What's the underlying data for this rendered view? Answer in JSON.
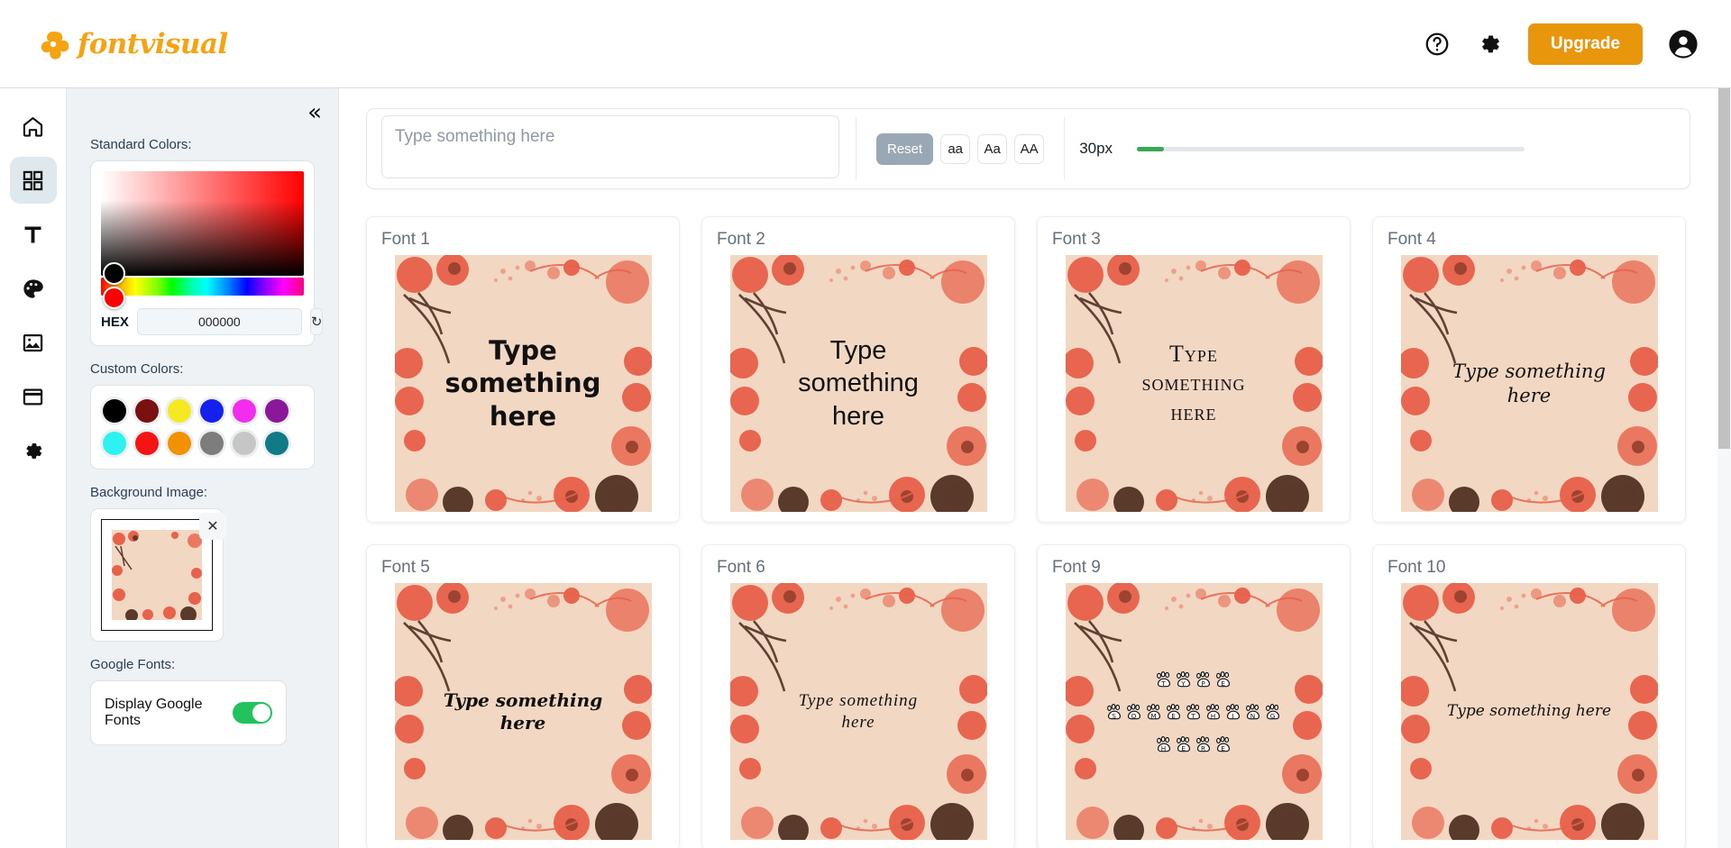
{
  "header": {
    "logo_text": "fontvisual",
    "logo_icon": "pinwheel-flower-icon",
    "help_icon": "question-circle-icon",
    "settings_icon": "gear-icon",
    "upgrade_label": "Upgrade",
    "account_icon": "user-circle-icon",
    "accent_color": "#E8960C"
  },
  "rail": {
    "items": [
      {
        "name": "home",
        "icon": "home-icon",
        "active": false
      },
      {
        "name": "templates",
        "icon": "grid-icon",
        "active": true
      },
      {
        "name": "text",
        "icon": "text-t-icon",
        "active": false
      },
      {
        "name": "colors",
        "icon": "palette-icon",
        "active": false
      },
      {
        "name": "images",
        "icon": "image-icon",
        "active": false
      },
      {
        "name": "frames",
        "icon": "window-icon",
        "active": false
      },
      {
        "name": "settings",
        "icon": "gear-icon",
        "active": false
      }
    ]
  },
  "panel": {
    "collapse_icon": "double-chevron-left-icon",
    "standard_colors_label": "Standard Colors:",
    "hex_label": "HEX",
    "hex_value": "000000",
    "refresh_icon": "refresh-icon",
    "custom_colors_label": "Custom Colors:",
    "custom_colors": [
      "#000000",
      "#7B1010",
      "#F7E920",
      "#1420EE",
      "#F22DEE",
      "#8B179B",
      "#2DF2F2",
      "#F51414",
      "#F39200",
      "#7D7D7D",
      "#C6C6C6",
      "#117A87"
    ],
    "background_image_label": "Background Image:",
    "background_remove_icon": "close-x-icon",
    "google_fonts_label": "Google Fonts:",
    "display_google_fonts_label": "Display Google Fonts",
    "display_google_fonts_on": true,
    "toggle_on_color": "#22c35e"
  },
  "toolbar": {
    "input_value": "",
    "input_placeholder": "Type something here",
    "reset_label": "Reset",
    "case_lower_label": "aa",
    "case_title_label": "Aa",
    "case_upper_label": "AA",
    "font_size_label": "30px",
    "slider_fill_color": "#3aa757"
  },
  "fonts": {
    "preview_text": "Type something here",
    "preview_bg_color": "#F2D7C2",
    "cards": [
      {
        "title": "Font 1",
        "style": "f1",
        "lines": [
          "Type",
          "something",
          "here"
        ]
      },
      {
        "title": "Font 2",
        "style": "f2",
        "lines": [
          "Type",
          "something",
          "here"
        ]
      },
      {
        "title": "Font 3",
        "style": "f3",
        "lines": [
          "Type",
          "something",
          "here"
        ]
      },
      {
        "title": "Font 4",
        "style": "f4",
        "lines": [
          "Type something",
          "here"
        ]
      },
      {
        "title": "Font 5",
        "style": "f5",
        "lines": [
          "Type something",
          "here"
        ]
      },
      {
        "title": "Font 6",
        "style": "f6",
        "lines": [
          "Type  something",
          "here"
        ]
      },
      {
        "title": "Font 9",
        "style": "f9",
        "lines": [
          "TYPE",
          "SOMETHING",
          "HERE"
        ],
        "paw": true
      },
      {
        "title": "Font 10",
        "style": "f10",
        "lines": [
          "Type something here"
        ]
      }
    ]
  }
}
